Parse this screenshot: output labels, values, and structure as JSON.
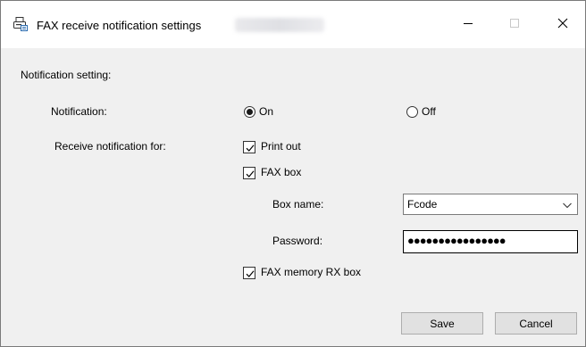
{
  "window": {
    "title": "FAX receive notification settings"
  },
  "section": {
    "title": "Notification setting:"
  },
  "notification": {
    "label": "Notification:",
    "on_label": "On",
    "off_label": "Off",
    "selected": "on"
  },
  "receive": {
    "label": "Receive notification for:",
    "print_out": {
      "label": "Print out",
      "checked": true
    },
    "fax_box": {
      "label": "FAX box",
      "checked": true
    },
    "fax_memory": {
      "label": "FAX memory RX box",
      "checked": true
    }
  },
  "box_name": {
    "label": "Box name:",
    "value": "Fcode"
  },
  "password": {
    "label": "Password:",
    "value": "●●●●●●●●●●●●●●●●"
  },
  "buttons": {
    "save": "Save",
    "cancel": "Cancel"
  },
  "icons": {
    "app": "fax-machine-icon",
    "minimize": "minimize-icon",
    "maximize": "maximize-icon",
    "close": "close-icon",
    "dropdown": "chevron-down-icon",
    "check": "checkmark-icon"
  }
}
